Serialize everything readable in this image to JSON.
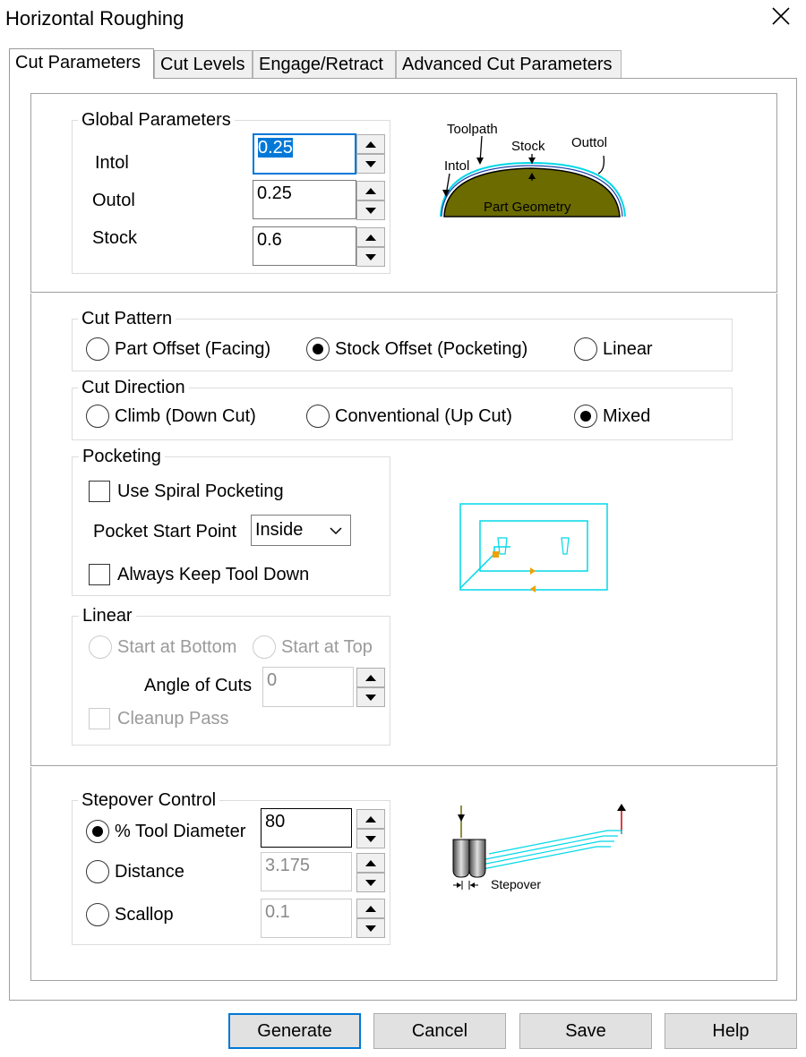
{
  "window": {
    "title": "Horizontal Roughing"
  },
  "tabs": [
    "Cut Parameters",
    "Cut Levels",
    "Engage/Retract",
    "Advanced Cut Parameters"
  ],
  "global_parameters": {
    "title": "Global Parameters",
    "intol_label": "Intol",
    "intol_value": "0.25",
    "outol_label": "Outol",
    "outol_value": "0.25",
    "stock_label": "Stock",
    "stock_value": "0.6"
  },
  "tolerance_diagram": {
    "toolpath": "Toolpath",
    "stock": "Stock",
    "outtol": "Outtol",
    "intol": "Intol",
    "part_geometry": "Part Geometry"
  },
  "cut_pattern": {
    "title": "Cut Pattern",
    "options": [
      "Part Offset (Facing)",
      "Stock Offset (Pocketing)",
      "Linear"
    ],
    "selected": "Stock Offset (Pocketing)"
  },
  "cut_direction": {
    "title": "Cut Direction",
    "options": [
      "Climb (Down Cut)",
      "Conventional (Up Cut)",
      "Mixed"
    ],
    "selected": "Mixed"
  },
  "pocketing": {
    "title": "Pocketing",
    "spiral_label": "Use Spiral Pocketing",
    "start_point_label": "Pocket Start Point",
    "start_point_value": "Inside",
    "keep_down_label": "Always Keep Tool Down"
  },
  "linear": {
    "title": "Linear",
    "start_bottom": "Start at Bottom",
    "start_top": "Start at Top",
    "angle_label": "Angle of Cuts",
    "angle_value": "0",
    "cleanup_label": "Cleanup Pass"
  },
  "stepover": {
    "title": "Stepover Control",
    "tool_diameter_label": "% Tool Diameter",
    "tool_diameter_value": "80",
    "distance_label": "Distance",
    "distance_value": "3.175",
    "scallop_label": "Scallop",
    "scallop_value": "0.1",
    "selected": "% Tool Diameter",
    "diagram_label": "Stepover"
  },
  "buttons": {
    "generate": "Generate",
    "cancel": "Cancel",
    "save": "Save",
    "help": "Help"
  },
  "colors": {
    "accent": "#0078d7",
    "part_fill": "#6b6b00",
    "cyan": "#00d8e8",
    "orange": "#f0a000"
  },
  "icons": {
    "close": "close-icon",
    "spin_up": "spin-up-icon",
    "spin_down": "spin-down-icon",
    "dropdown": "chevron-down-icon"
  }
}
